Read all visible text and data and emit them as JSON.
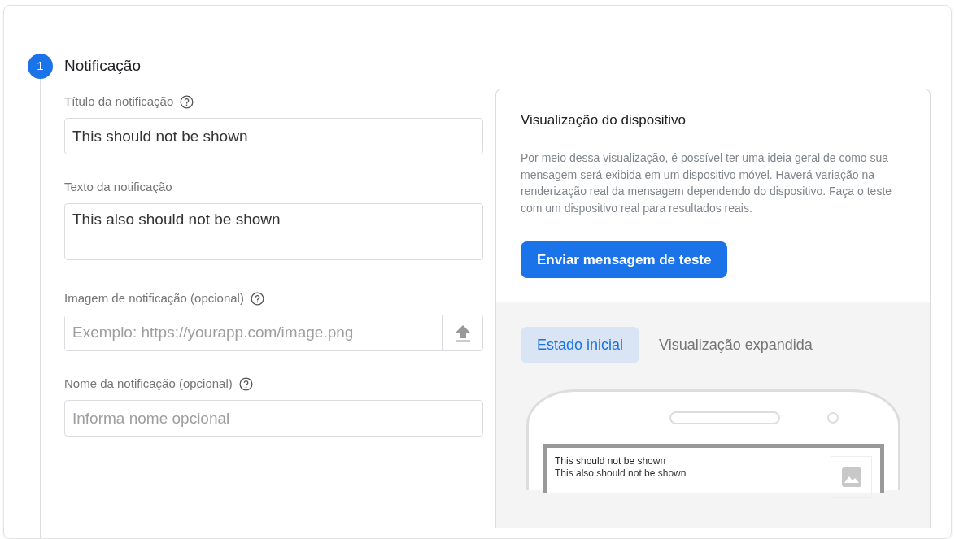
{
  "step": {
    "number": "1",
    "title": "Notificação"
  },
  "fields": [
    {
      "kind": "text",
      "label": "Título da notificação",
      "help": true,
      "value": "This should not be shown"
    },
    {
      "kind": "textarea",
      "label": "Texto da notificação",
      "help": false,
      "value": "This also should not be shown"
    },
    {
      "kind": "upload",
      "label": "Imagem de notificação (opcional)",
      "help": true,
      "placeholder": "Exemplo: https://yourapp.com/image.png"
    },
    {
      "kind": "text",
      "label": "Nome da notificação (opcional)",
      "help": true,
      "placeholder": "Informa nome opcional"
    }
  ],
  "preview": {
    "title": "Visualização do dispositivo",
    "description": "Por meio dessa visualização, é possível ter uma ideia geral de como sua mensagem será exibida em um dispositivo móvel. Haverá variação na renderização real da mensagem dependendo do dispositivo. Faça o teste com um dispositivo real para resultados reais.",
    "button": "Enviar mensagem de teste",
    "tabs": [
      {
        "label": "Estado inicial",
        "selected": true
      },
      {
        "label": "Visualização expandida",
        "selected": false
      }
    ],
    "notification": {
      "title": "This should not be shown",
      "text": "This also should not be shown"
    }
  }
}
